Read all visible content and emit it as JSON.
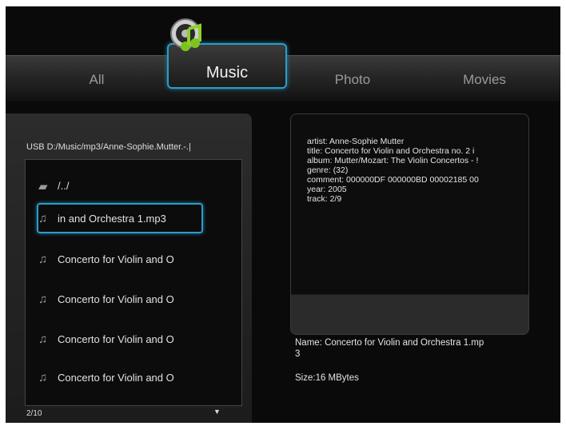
{
  "tabs": {
    "all": "All",
    "music": "Music",
    "photo": "Photo",
    "movies": "Movies"
  },
  "browser": {
    "path": "USB D:/Music/mp3/Anne-Sophie.Mutter.-.|",
    "rows": [
      {
        "label": "/../",
        "icon": "folder-icon"
      },
      {
        "label": "in and Orchestra 1.mp3",
        "icon": "music-note-icon",
        "selected": true
      },
      {
        "label": "Concerto for Violin and O",
        "icon": "music-note-icon"
      },
      {
        "label": "Concerto for Violin and O",
        "icon": "music-note-icon"
      },
      {
        "label": "Concerto for Violin and O",
        "icon": "music-note-icon"
      },
      {
        "label": "Concerto for Violin and O",
        "icon": "music-note-icon"
      }
    ],
    "page": "2/10"
  },
  "info": {
    "tags": [
      "artist: Anne-Sophie Mutter",
      "title: Concerto for Violin and Orchestra no. 2 i",
      "album: Mutter/Mozart: The Violin Concertos - !",
      "genre: (32)",
      "comment:  000000DF 000000BD 00002185 00",
      "year: 2005",
      "track: 2/9"
    ],
    "name": "Name: Concerto for Violin and Orchestra 1.mp",
    "name_wrap": "3",
    "size": "Size:16 MBytes"
  },
  "colors": {
    "accent": "#2d9cc6",
    "background": "#0a0a0a"
  }
}
